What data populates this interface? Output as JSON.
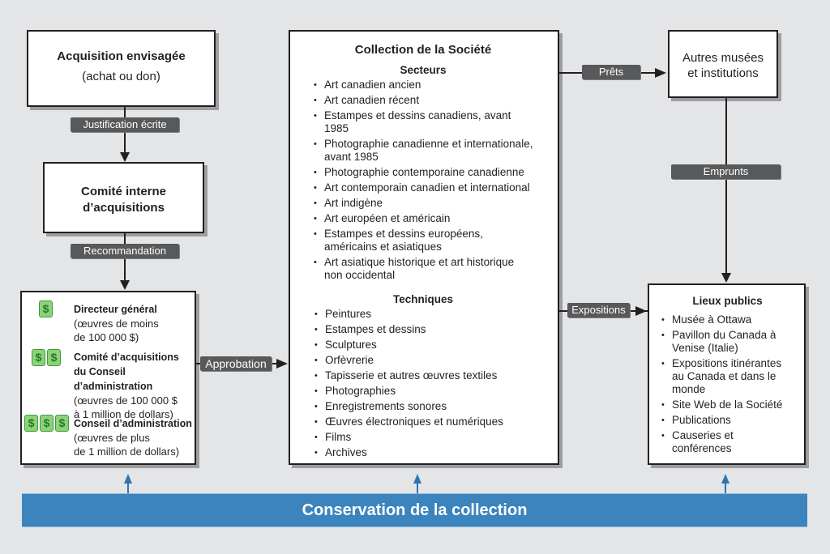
{
  "acquisition": {
    "title": "Acquisition envisagée",
    "subtitle": "(achat ou don)"
  },
  "committee": {
    "line1": "Comité interne",
    "line2": "d’acquisitions"
  },
  "connectors": {
    "justification": "Justification écrite",
    "recommendation": "Recommandation",
    "approval": "Approbation",
    "loans": "Prêts",
    "borrowings": "Emprunts",
    "exhibitions": "Expositions"
  },
  "authority": [
    {
      "icon_count": 1,
      "icon": "dollar-icon",
      "title": "Directeur général",
      "desc1": "(œuvres de moins",
      "desc2": "de 100 000 $)"
    },
    {
      "icon_count": 2,
      "icon": "dollar-icon",
      "title": "Comité d’acquisitions",
      "title2": "du Conseil  d’administration",
      "desc1": "(œuvres de 100 000 $",
      "desc2": "à 1 million de dollars)"
    },
    {
      "icon_count": 3,
      "icon": "dollar-icon",
      "title": "Conseil d’administration",
      "desc1": "(œuvres de plus",
      "desc2": "de 1 million de dollars)"
    }
  ],
  "collection": {
    "title": "Collection de la Société",
    "sectors_heading": "Secteurs",
    "sectors": [
      "Art canadien ancien",
      "Art canadien récent",
      "Estampes et dessins canadiens, avant 1985",
      "Photographie canadienne et internationale, avant 1985",
      "Photographie contemporaine canadienne",
      "Art contemporain canadien et international",
      "Art indigène",
      "Art européen et américain",
      "Estampes et dessins européens, américains et asiatiques",
      "Art asiatique historique et art historique non occidental"
    ],
    "techniques_heading": "Techniques",
    "techniques": [
      "Peintures",
      "Estampes et dessins",
      "Sculptures",
      "Orfèvrerie",
      "Tapisserie et autres œuvres textiles",
      "Photographies",
      "Enregistrements sonores",
      "Œuvres électroniques et numériques",
      "Films",
      "Archives"
    ]
  },
  "other_museums": {
    "line1": "Autres musées",
    "line2": "et institutions"
  },
  "public_venues": {
    "title": "Lieux publics",
    "items": [
      "Musée à Ottawa",
      "Pavillon du Canada à Venise (Italie)",
      "Expositions itinérantes au Canada et dans le monde",
      "Site Web de la Société",
      "Publications",
      "Causeries et conférences"
    ]
  },
  "conservation": {
    "label": "Conservation de la collection",
    "color": "#3b84bd"
  }
}
